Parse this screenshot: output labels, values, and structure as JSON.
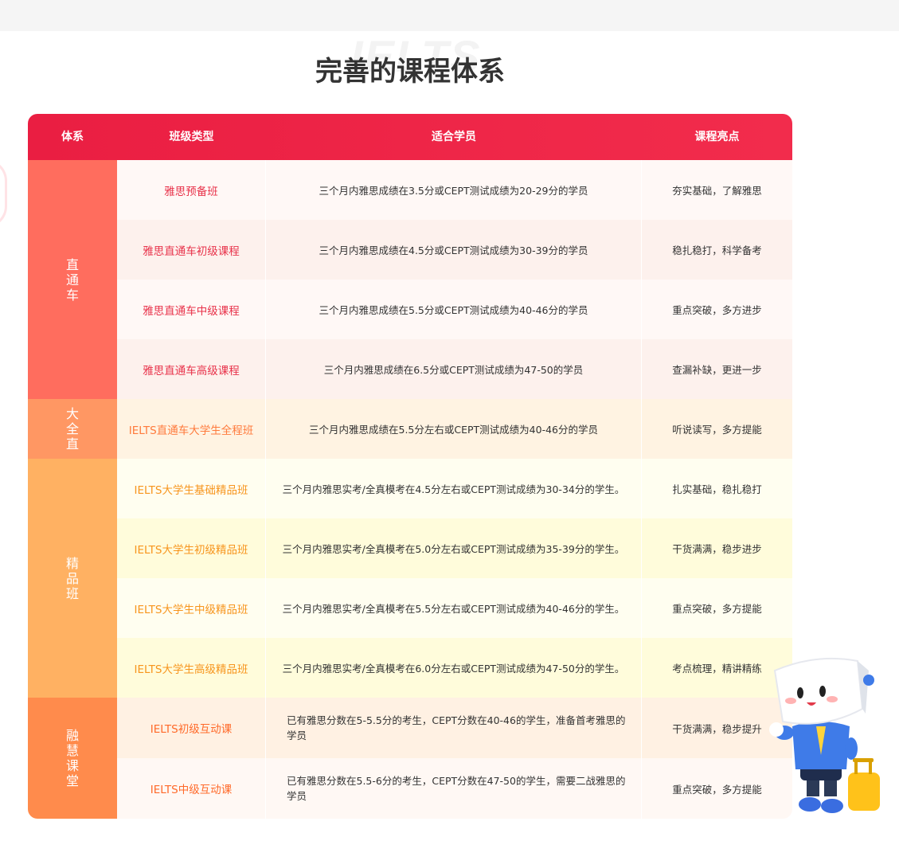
{
  "page": {
    "watermark": "IELTS",
    "title": "完善的课程体系"
  },
  "table": {
    "headers": [
      "体系",
      "班级类型",
      "适合学员",
      "课程亮点"
    ],
    "groups": [
      {
        "label": "直通车",
        "color": "#ff6d5e"
      },
      {
        "label": "大全直",
        "color": "#ff9763"
      },
      {
        "label": "精品班",
        "color": "#ffb162"
      },
      {
        "label": "融慧课堂",
        "color": "#ff8b4c"
      }
    ],
    "rows": [
      {
        "name": "雅思预备班",
        "audience": "三个月内雅思成绩在3.5分或CEPT测试成绩为20-29分的学员",
        "highlight": "夯实基础，了解雅思",
        "bg": "#fff8f6",
        "name_color": "#e8324a"
      },
      {
        "name": "雅思直通车初级课程",
        "audience": "三个月内雅思成绩在4.5分或CEPT测试成绩为30-39分的学员",
        "highlight": "稳扎稳打，科学备考",
        "bg": "#fdf1ed",
        "name_color": "#e8324a"
      },
      {
        "name": "雅思直通车中级课程",
        "audience": "三个月内雅思成绩在5.5分或CEPT测试成绩为40-46分的学员",
        "highlight": "重点突破，多方进步",
        "bg": "#fff8f6",
        "name_color": "#e8324a"
      },
      {
        "name": "雅思直通车高级课程",
        "audience": "三个月内雅思成绩在6.5分或CEPT测试成绩为47-50的学员",
        "highlight": "查漏补缺，更进一步",
        "bg": "#fdf1ed",
        "name_color": "#e8324a"
      },
      {
        "name": "IELTS直通车大学生全程班",
        "audience": "三个月内雅思成绩在5.5分左右或CEPT测试成绩为40-46分的学员",
        "highlight": "听说读写，多方提能",
        "bg": "#fff3e2",
        "name_color": "#ff7a3c"
      },
      {
        "name": "IELTS大学生基础精品班",
        "audience": "三个月内雅思实考/全真模考在4.5分左右或CEPT测试成绩为30-34分的学生。",
        "highlight": "扎实基础，稳扎稳打",
        "bg": "#fffef0",
        "name_color": "#f7951d"
      },
      {
        "name": "IELTS大学生初级精品班",
        "audience": "三个月内雅思实考/全真模考在5.0分左右或CEPT测试成绩为35-39分的学生。",
        "highlight": "干货满满，稳步进步",
        "bg": "#fffcdb",
        "name_color": "#f7951d"
      },
      {
        "name": "IELTS大学生中级精品班",
        "audience": "三个月内雅思实考/全真模考在5.5分左右或CEPT测试成绩为40-46分的学生。",
        "highlight": "重点突破，多方提能",
        "bg": "#fffef0",
        "name_color": "#f7951d"
      },
      {
        "name": "IELTS大学生高级精品班",
        "audience": "三个月内雅思实考/全真模考在6.0分左右或CEPT测试成绩为47-50分的学生。",
        "highlight": "考点梳理，精讲精练",
        "bg": "#fffcdb",
        "name_color": "#f7951d"
      },
      {
        "name": "IELTS初级互动课",
        "audience": "已有雅思分数在5-5.5分的考生，CEPT分数在40-46的学生，准备首考雅思的学员",
        "highlight": "干货满满，稳步提升",
        "bg": "#fff1e3",
        "name_color": "#ff6a2a"
      },
      {
        "name": "IELTS中级互动课",
        "audience": "已有雅思分数在5.5-6分的考生，CEPT分数在47-50的学生，需要二战雅思的学员",
        "highlight": "重点突破，多方提能",
        "bg": "#fff8f4",
        "name_color": "#ff6a2a"
      }
    ]
  }
}
